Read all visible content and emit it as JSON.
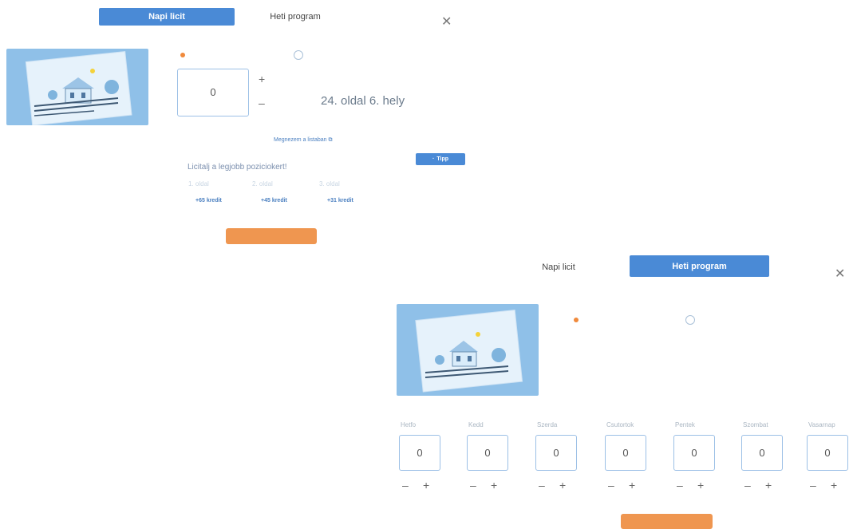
{
  "top_panel": {
    "tabs": [
      {
        "label": "Napi licit",
        "active": true
      },
      {
        "label": "Heti program",
        "active": false
      }
    ],
    "close_icon": "close-icon",
    "status_text": "",
    "clock_text": "",
    "bid_value": "0",
    "bid_unit": "",
    "plus": "+",
    "minus": "–",
    "place_caption": "",
    "place_text": "24. oldal 6. hely",
    "info_text": "",
    "credit_link": "",
    "view_link": "Megnezem a listaban",
    "tip_button": "Tipp",
    "promo_title": "Licitalj a legjobb poziciokert!",
    "positions": [
      {
        "label": "1. oldal",
        "credit": "+65 kredit"
      },
      {
        "label": "2. oldal",
        "credit": "+45 kredit"
      },
      {
        "label": "3. oldal",
        "credit": "+31 kredit"
      }
    ],
    "cancel_label": "",
    "save_button": ""
  },
  "bottom_panel": {
    "tabs": [
      {
        "label": "Napi licit",
        "active": false
      },
      {
        "label": "Heti program",
        "active": true
      }
    ],
    "close_icon": "close-icon",
    "status_text": "",
    "clock_text": "",
    "days": [
      {
        "name": "Hetfo",
        "value": "0"
      },
      {
        "name": "Kedd",
        "value": "0"
      },
      {
        "name": "Szerda",
        "value": "0"
      },
      {
        "name": "Csutortok",
        "value": "0"
      },
      {
        "name": "Pentek",
        "value": "0"
      },
      {
        "name": "Szombat",
        "value": "0"
      },
      {
        "name": "Vasarnap",
        "value": "0"
      }
    ],
    "minus": "–",
    "plus": "+",
    "cancel_label": "",
    "save_button": ""
  },
  "colors": {
    "accent_blue": "#4a8ad6",
    "accent_orange": "#ef9650",
    "thumb_blue": "#8fc0e8"
  }
}
